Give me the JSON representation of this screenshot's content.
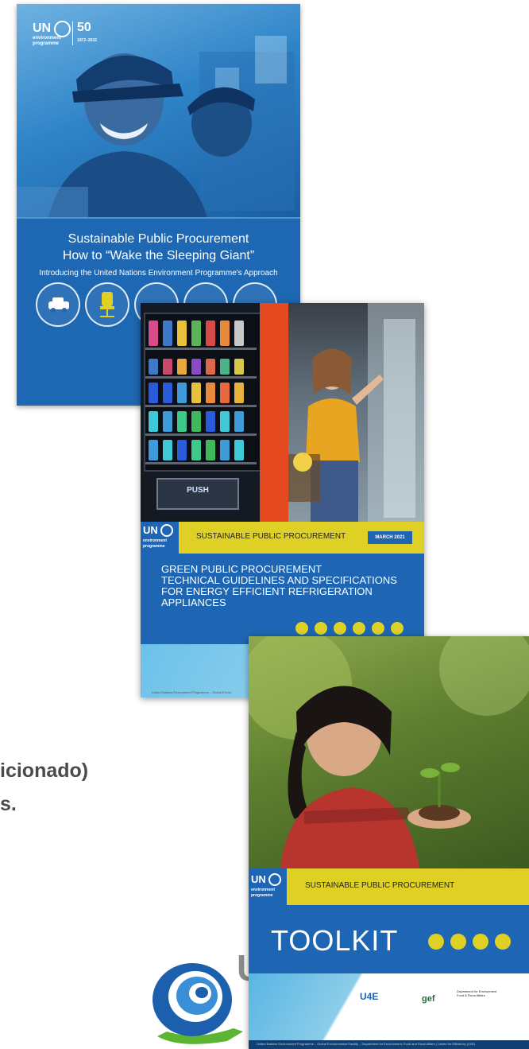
{
  "background": {
    "line1": "icionado)",
    "line2": "s."
  },
  "cover1": {
    "title_line1": "Sustainable Public Procurement",
    "title_line2": "How to “Wake the Sleeping Giant”",
    "subtitle": "Introducing the United Nations Environment Programme's Approach",
    "logo_un": "UN",
    "logo_env": "environment",
    "logo_prog": "programme",
    "logo_50": "50",
    "logo_years": "1972–2022"
  },
  "cover2": {
    "series": "SUSTAINABLE PUBLIC PROCUREMENT",
    "date": "MARCH 2021",
    "title_line1": "GREEN PUBLIC PROCUREMENT",
    "title_line2": "TECHNICAL GUIDELINES AND SPECIFICATIONS",
    "title_line3": "FOR ENERGY EFFICIENT REFRIGERATION",
    "title_line4": "APPLIANCES",
    "push_label": "PUSH",
    "logo_un": "UN",
    "logo_env": "environment",
    "logo_prog": "programme",
    "footer": "United Nations Environment Programme – Global Enviro"
  },
  "cover3": {
    "series": "SUSTAINABLE PUBLIC PROCUREMENT",
    "title": "TOOLKIT",
    "logo_un": "UN",
    "logo_env": "environment",
    "logo_prog": "programme",
    "partner_u4e": "U4E",
    "partner_gef": "gef",
    "partner_defra": "Department for Environment Food & Rural Affairs",
    "footer": "United Nations Environment Programme – Global Environmental Facility – Department for Environment, Food and Rural Affairs | United for Efficiency (U4E)"
  },
  "colors": {
    "un_blue": "#1e66b4",
    "yellow": "#dfd026",
    "light_blue": "#6cc1e9"
  }
}
